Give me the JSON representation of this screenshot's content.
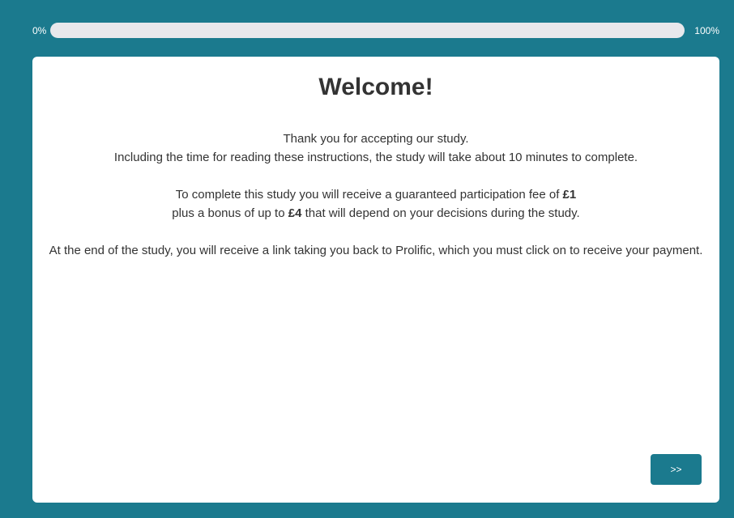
{
  "progress": {
    "min_label": "0%",
    "max_label": "100%",
    "value": 0
  },
  "page": {
    "title": "Welcome!",
    "para1": {
      "line1": "Thank you for accepting our study.",
      "line2": "Including the time for reading these instructions, the study will take about 10 minutes to complete."
    },
    "para2": {
      "line1_prefix": "To complete this study you will receive a guaranteed participation fee of ",
      "fee": "£1",
      "line2_prefix": "plus a bonus of up to ",
      "bonus": "£4",
      "line2_suffix": " that will depend on your decisions during the study."
    },
    "para3": "At the end of the study, you will receive a link taking you back to Prolific, which you must click on to receive your payment."
  },
  "buttons": {
    "next_label": ">>"
  },
  "colors": {
    "background": "#1b7a8e",
    "card": "#ffffff",
    "progress_track": "#e8e8ec",
    "text": "#333333"
  }
}
